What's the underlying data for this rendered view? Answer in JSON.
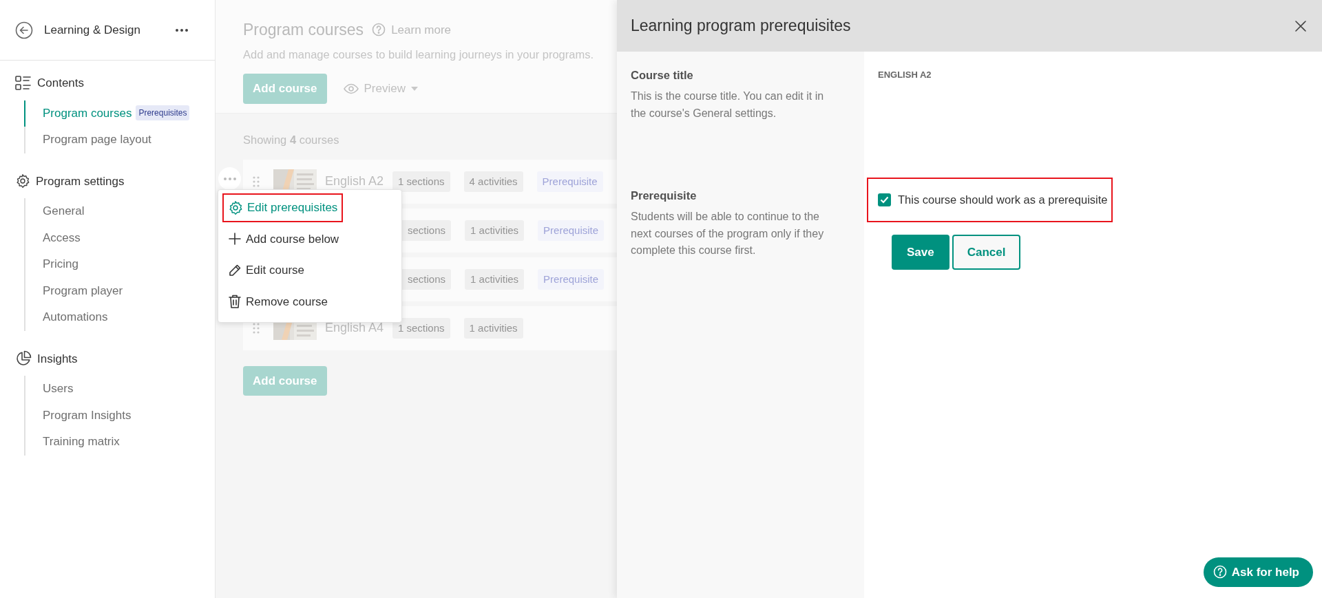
{
  "sidebar": {
    "title": "Learning & Design",
    "sections": [
      {
        "title": "Contents",
        "items": [
          {
            "label": "Program courses",
            "selected": true,
            "badge": "Prerequisites"
          },
          {
            "label": "Program page layout",
            "selected": false
          }
        ]
      },
      {
        "title": "Program settings",
        "items": [
          {
            "label": "General",
            "selected": false
          },
          {
            "label": "Access",
            "selected": false
          },
          {
            "label": "Pricing",
            "selected": false
          },
          {
            "label": "Program player",
            "selected": false
          },
          {
            "label": "Automations",
            "selected": false
          }
        ]
      },
      {
        "title": "Insights",
        "items": [
          {
            "label": "Users",
            "selected": false
          },
          {
            "label": "Program Insights",
            "selected": false
          },
          {
            "label": "Training matrix",
            "selected": false
          }
        ]
      }
    ]
  },
  "main": {
    "title": "Program courses",
    "learn_more": "Learn more",
    "subtitle": "Add and manage courses to build learning journeys in your programs.",
    "add_course": "Add course",
    "preview": "Preview",
    "showing": "Showing **4** courses",
    "courses": [
      {
        "name": "English A2",
        "sections": "1 sections",
        "activities": "4 activities",
        "tag": "Prerequisite"
      },
      {
        "sections": "sections",
        "activities": "1 activities",
        "tag": "Prerequisite"
      },
      {
        "sections": "sections",
        "activities": "1 activities",
        "tag": "Prerequisite"
      },
      {
        "name": "English A4",
        "sections": "1 sections",
        "activities": "1 activities"
      }
    ],
    "add_course_bottom": "Add course"
  },
  "context_menu": {
    "items": [
      {
        "label": "Edit prerequisites",
        "selected": true,
        "highlighted": true
      },
      {
        "label": "Add course below",
        "selected": false,
        "highlighted": false
      },
      {
        "label": "Edit course",
        "selected": false,
        "highlighted": false
      },
      {
        "label": "Remove course",
        "selected": false,
        "highlighted": false
      }
    ]
  },
  "panel": {
    "title": "Learning program prerequisites",
    "fields": [
      {
        "kind": "text",
        "label": "Course title",
        "description": "This is the course title. You can edit it in the course's General settings.",
        "value": "ENGLISH A2"
      },
      {
        "kind": "checkbox",
        "label": "Prerequisite",
        "description": "Students will be able to continue to the next courses of the program only if they complete this course first.",
        "option": "This course should work as a prerequisite",
        "checked": true,
        "highlighted": true
      }
    ],
    "save": "Save",
    "cancel": "Cancel"
  },
  "help_button": "Ask for help"
}
